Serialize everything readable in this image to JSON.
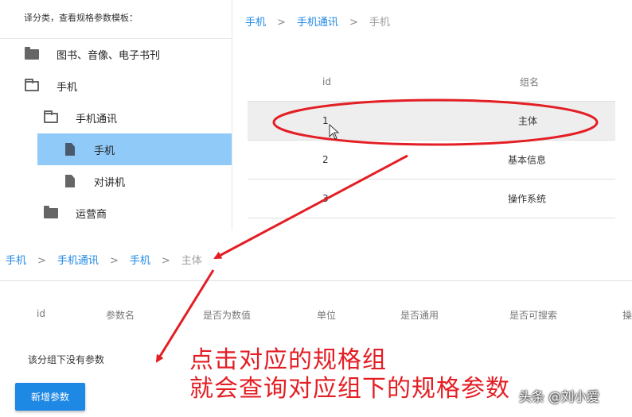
{
  "tree": {
    "hint": "译分类，查看规格参数模板：",
    "nodes": [
      {
        "label": "图书、音像、电子书刊",
        "icon": "folder-icon"
      },
      {
        "label": "手机",
        "icon": "folder-open-icon"
      },
      {
        "label": "手机通讯",
        "icon": "folder-open-icon"
      },
      {
        "label": "手机",
        "icon": "file-icon",
        "selected": true
      },
      {
        "label": "对讲机",
        "icon": "file-icon"
      },
      {
        "label": "运营商",
        "icon": "folder-icon"
      }
    ]
  },
  "top_breadcrumb": {
    "items": [
      "手机",
      "手机通讯",
      "手机"
    ],
    "separator": ">"
  },
  "group_table": {
    "headers": [
      "id",
      "组名"
    ],
    "rows": [
      {
        "id": "1",
        "name": "主体"
      },
      {
        "id": "2",
        "name": "基本信息"
      },
      {
        "id": "3",
        "name": "操作系统"
      }
    ]
  },
  "bottom_breadcrumb": {
    "items": [
      "手机",
      "手机通讯",
      "手机",
      "主体"
    ],
    "separator": ">"
  },
  "param_table": {
    "headers": [
      "id",
      "参数名",
      "是否为数值",
      "单位",
      "是否通用",
      "是否可搜索",
      "操"
    ],
    "empty_message": "该分组下没有参数"
  },
  "add_button_label": "新增参数",
  "annotation": {
    "line1": "点击对应的规格组",
    "line2": "就会查询对应组下的规格参数"
  },
  "watermark": "头条 @刘小爱",
  "colors": {
    "accent": "#1e88e5",
    "selected_row": "#90caf9",
    "annotation": "#e31e24"
  }
}
